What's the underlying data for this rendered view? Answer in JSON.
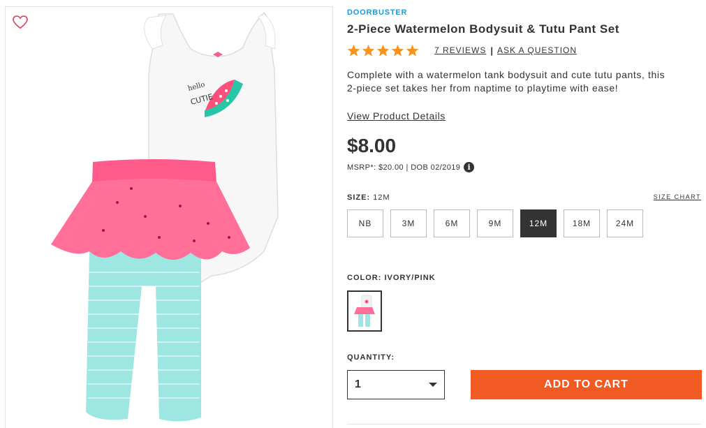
{
  "product": {
    "badge": "DOORBUSTER",
    "title": "2-Piece Watermelon Bodysuit & Tutu Pant Set",
    "rating_stars": 5,
    "reviews_label": "7 REVIEWS",
    "ask_label": "ASK A QUESTION",
    "description": "Complete with a watermelon tank bodysuit and cute tutu pants, this 2-piece set takes her from naptime to playtime with ease!",
    "details_link": "View Product Details",
    "price": "$8.00",
    "msrp_text": "MSRP*: $20.00 | DOB 02/2019",
    "info_glyph": "i"
  },
  "size": {
    "label": "SIZE:",
    "selected": "12M",
    "chart_label": "SIZE CHART",
    "options": [
      "NB",
      "3M",
      "6M",
      "9M",
      "12M",
      "18M",
      "24M"
    ]
  },
  "color": {
    "label": "COLOR: IVORY/PINK"
  },
  "quantity": {
    "label": "QUANTITY:",
    "value": "1"
  },
  "cart": {
    "add_label": "ADD TO CART"
  },
  "colors": {
    "accent_blue": "#1d9ad6",
    "star_orange": "#f7931e",
    "cta_orange": "#f15a22",
    "selected_dark": "#333333"
  },
  "icons": {
    "favorite": "heart-outline-icon",
    "rating": "star-icon",
    "info": "info-icon",
    "dropdown": "chevron-down-icon"
  }
}
